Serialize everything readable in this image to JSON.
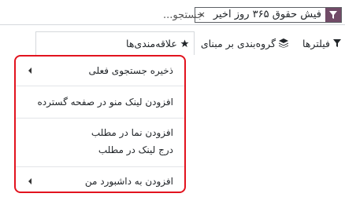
{
  "search": {
    "facet_label": "فیش حقوق ۳۶۵ روز اخیر",
    "facet_remove": "×",
    "placeholder": "جستجو..."
  },
  "toolbar": {
    "filters_label": "فیلترها",
    "groupby_label": "گروه‌بندی بر مبنای",
    "favorites_label": "علاقه‌مندی‌ها"
  },
  "favorites_menu": {
    "items": [
      {
        "label": "ذخیره جستجوی فعلی",
        "has_submenu": true
      },
      {
        "label": "افزودن لینک منو در صفحه گسترده",
        "has_submenu": false
      },
      {
        "label": "افزودن نما در مطلب",
        "has_submenu": false
      },
      {
        "label": "درج لینک در مطلب",
        "has_submenu": false
      },
      {
        "label": "افزودن به داشبورد من",
        "has_submenu": true
      }
    ]
  },
  "colors": {
    "accent": "#714b67",
    "highlight_border": "#e2131e"
  },
  "icons": {
    "facet": "filter-icon",
    "filters": "filter-icon",
    "groupby": "layers-icon",
    "favorites": "star-icon"
  }
}
